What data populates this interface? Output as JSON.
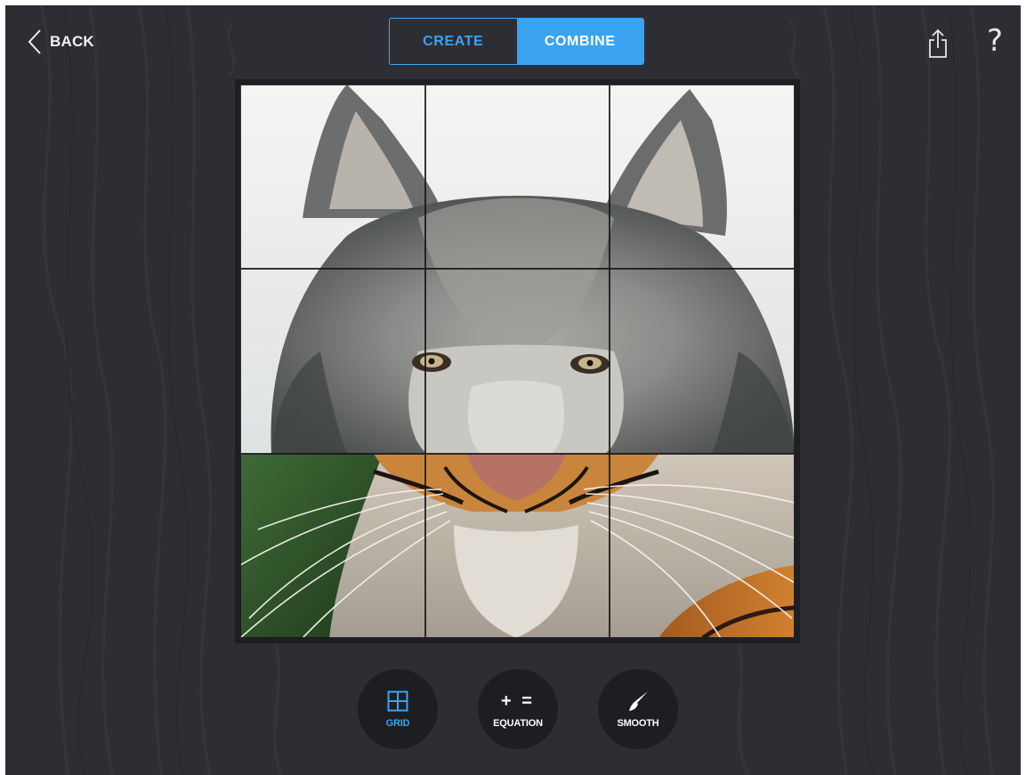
{
  "topbar": {
    "back_label": "BACK",
    "tabs": [
      {
        "label": "CREATE",
        "selected": false
      },
      {
        "label": "COMBINE",
        "selected": true
      }
    ],
    "help_label": "?"
  },
  "puzzle": {
    "rows": 3,
    "cols": 3,
    "top_animal": "wolf",
    "bottom_animal": "tiger"
  },
  "tools": {
    "grid_label": "GRID",
    "equation_symbols": "+ =",
    "equation_label": "EQUATION",
    "smooth_label": "SMOOTH",
    "active": "grid"
  },
  "colors": {
    "accent": "#3aa3f2",
    "background": "#2d2e33",
    "tool_button": "#1d1e22"
  },
  "icons": {
    "back": "chevron-left-icon",
    "share": "share-icon",
    "help": "question-mark-icon",
    "grid": "grid-icon",
    "smooth": "brush-icon"
  }
}
